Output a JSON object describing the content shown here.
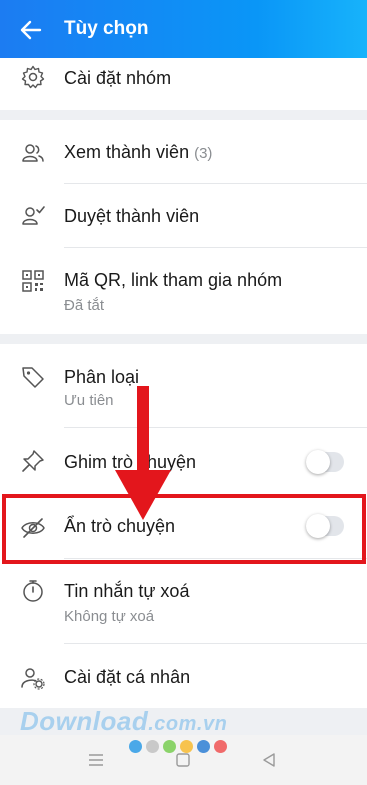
{
  "header": {
    "title": "Tùy chọn",
    "icon": "back-arrow-icon"
  },
  "items": {
    "group_settings": {
      "label": "Cài đặt nhóm",
      "icon": "gear-icon"
    },
    "view_members": {
      "label": "Xem thành viên",
      "count": "(3)",
      "icon": "members-icon"
    },
    "approve_members": {
      "label": "Duyệt thành viên",
      "icon": "approve-member-icon"
    },
    "qr_link": {
      "label": "Mã QR, link tham gia nhóm",
      "sub": "Đã tắt",
      "icon": "qr-code-icon"
    },
    "classify": {
      "label": "Phân loại",
      "sub": "Ưu tiên",
      "icon": "tag-icon"
    },
    "pin_chat": {
      "label": "Ghim trò chuyện",
      "icon": "pin-icon",
      "toggle_on": false
    },
    "hide_chat": {
      "label": "Ẩn trò chuyện",
      "icon": "eye-off-icon",
      "toggle_on": false
    },
    "auto_delete": {
      "label": "Tin nhắn tự xoá",
      "sub": "Không tự xoá",
      "icon": "timer-icon"
    },
    "personal_settings": {
      "label": "Cài đặt cá nhân",
      "icon": "user-settings-icon"
    }
  },
  "watermark": {
    "main": "Download",
    "domain": ".com.vn"
  },
  "colors": {
    "accent": "#0a8cf5",
    "highlight": "#e3161c",
    "dots": [
      "#4aa8e8",
      "#c9c9c9",
      "#8bd36a",
      "#f7c34e",
      "#4a90d9",
      "#f06a6a"
    ]
  },
  "navbar": {
    "icons": [
      "menu-icon",
      "home-square-icon",
      "back-triangle-icon"
    ]
  }
}
